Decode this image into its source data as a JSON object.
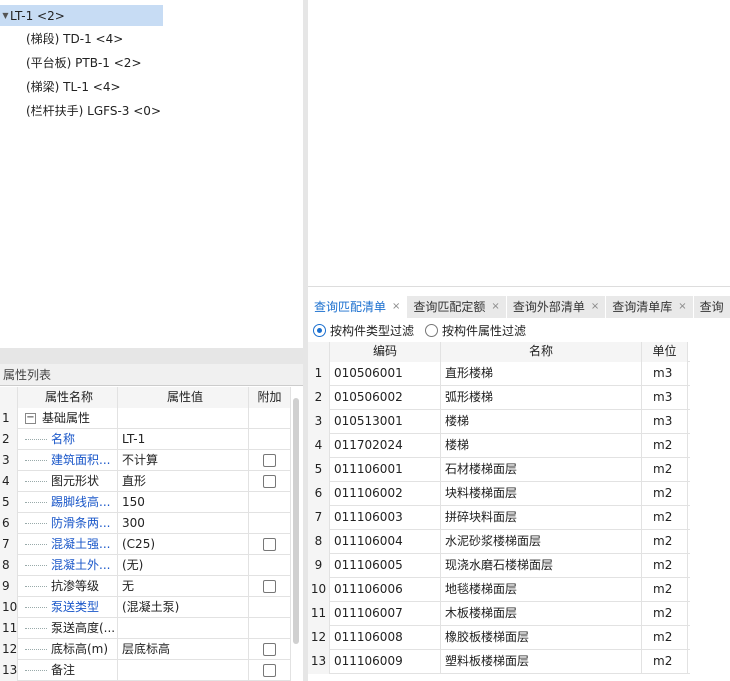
{
  "tree": {
    "root_label": "LT-1 <2>",
    "children": [
      "(梯段) TD-1 <4>",
      "(平台板) PTB-1 <2>",
      "(梯梁) TL-1 <4>",
      "(栏杆扶手) LGFS-3 <0>"
    ]
  },
  "properties": {
    "panel_title": "属性列表",
    "headers": {
      "name": "属性名称",
      "value": "属性值",
      "extra": "附加"
    },
    "rows": [
      {
        "idx": "1",
        "name": "基础属性",
        "value": "",
        "group": true,
        "blue": false,
        "checkbox": false
      },
      {
        "idx": "2",
        "name": "名称",
        "value": "LT-1",
        "group": false,
        "blue": true,
        "checkbox": false
      },
      {
        "idx": "3",
        "name": "建筑面积...",
        "value": "不计算",
        "group": false,
        "blue": true,
        "checkbox": true
      },
      {
        "idx": "4",
        "name": "图元形状",
        "value": "直形",
        "group": false,
        "blue": false,
        "checkbox": true
      },
      {
        "idx": "5",
        "name": "踢脚线高...",
        "value": "150",
        "group": false,
        "blue": true,
        "checkbox": false
      },
      {
        "idx": "6",
        "name": "防滑条两...",
        "value": "300",
        "group": false,
        "blue": true,
        "checkbox": false
      },
      {
        "idx": "7",
        "name": "混凝土强...",
        "value": "(C25)",
        "group": false,
        "blue": true,
        "checkbox": true
      },
      {
        "idx": "8",
        "name": "混凝土外...",
        "value": "(无)",
        "group": false,
        "blue": true,
        "checkbox": false
      },
      {
        "idx": "9",
        "name": "抗渗等级",
        "value": "无",
        "group": false,
        "blue": false,
        "checkbox": true
      },
      {
        "idx": "10",
        "name": "泵送类型",
        "value": "(混凝土泵)",
        "group": false,
        "blue": true,
        "checkbox": false
      },
      {
        "idx": "11",
        "name": "泵送高度(...",
        "value": "",
        "group": false,
        "blue": false,
        "checkbox": false
      },
      {
        "idx": "12",
        "name": "底标高(m)",
        "value": "层底标高",
        "group": false,
        "blue": false,
        "checkbox": true
      },
      {
        "idx": "13",
        "name": "备注",
        "value": "",
        "group": false,
        "blue": false,
        "checkbox": true
      }
    ]
  },
  "tabs": [
    {
      "label": "查询匹配清单",
      "active": true
    },
    {
      "label": "查询匹配定额",
      "active": false
    },
    {
      "label": "查询外部清单",
      "active": false
    },
    {
      "label": "查询清单库",
      "active": false
    },
    {
      "label": "查询",
      "active": false
    }
  ],
  "tab_close": "×",
  "filter": {
    "option1": "按构件类型过滤",
    "option2": "按构件属性过滤",
    "selected": "option1"
  },
  "results": {
    "headers": {
      "code": "编码",
      "name": "名称",
      "unit": "单位"
    },
    "rows": [
      {
        "idx": "1",
        "code": "010506001",
        "name": "直形楼梯",
        "unit": "m3"
      },
      {
        "idx": "2",
        "code": "010506002",
        "name": "弧形楼梯",
        "unit": "m3"
      },
      {
        "idx": "3",
        "code": "010513001",
        "name": "楼梯",
        "unit": "m3"
      },
      {
        "idx": "4",
        "code": "011702024",
        "name": "楼梯",
        "unit": "m2"
      },
      {
        "idx": "5",
        "code": "011106001",
        "name": "石材楼梯面层",
        "unit": "m2"
      },
      {
        "idx": "6",
        "code": "011106002",
        "name": "块料楼梯面层",
        "unit": "m2"
      },
      {
        "idx": "7",
        "code": "011106003",
        "name": "拼碎块料面层",
        "unit": "m2"
      },
      {
        "idx": "8",
        "code": "011106004",
        "name": "水泥砂浆楼梯面层",
        "unit": "m2"
      },
      {
        "idx": "9",
        "code": "011106005",
        "name": "现浇水磨石楼梯面层",
        "unit": "m2"
      },
      {
        "idx": "10",
        "code": "011106006",
        "name": "地毯楼梯面层",
        "unit": "m2"
      },
      {
        "idx": "11",
        "code": "011106007",
        "name": "木板楼梯面层",
        "unit": "m2"
      },
      {
        "idx": "12",
        "code": "011106008",
        "name": "橡胶板楼梯面层",
        "unit": "m2"
      },
      {
        "idx": "13",
        "code": "011106009",
        "name": "塑料板楼梯面层",
        "unit": "m2"
      }
    ]
  },
  "colors": {
    "selection": "#c7dcf4",
    "accent": "#1a6fcf",
    "link_blue": "#1a57c9"
  }
}
